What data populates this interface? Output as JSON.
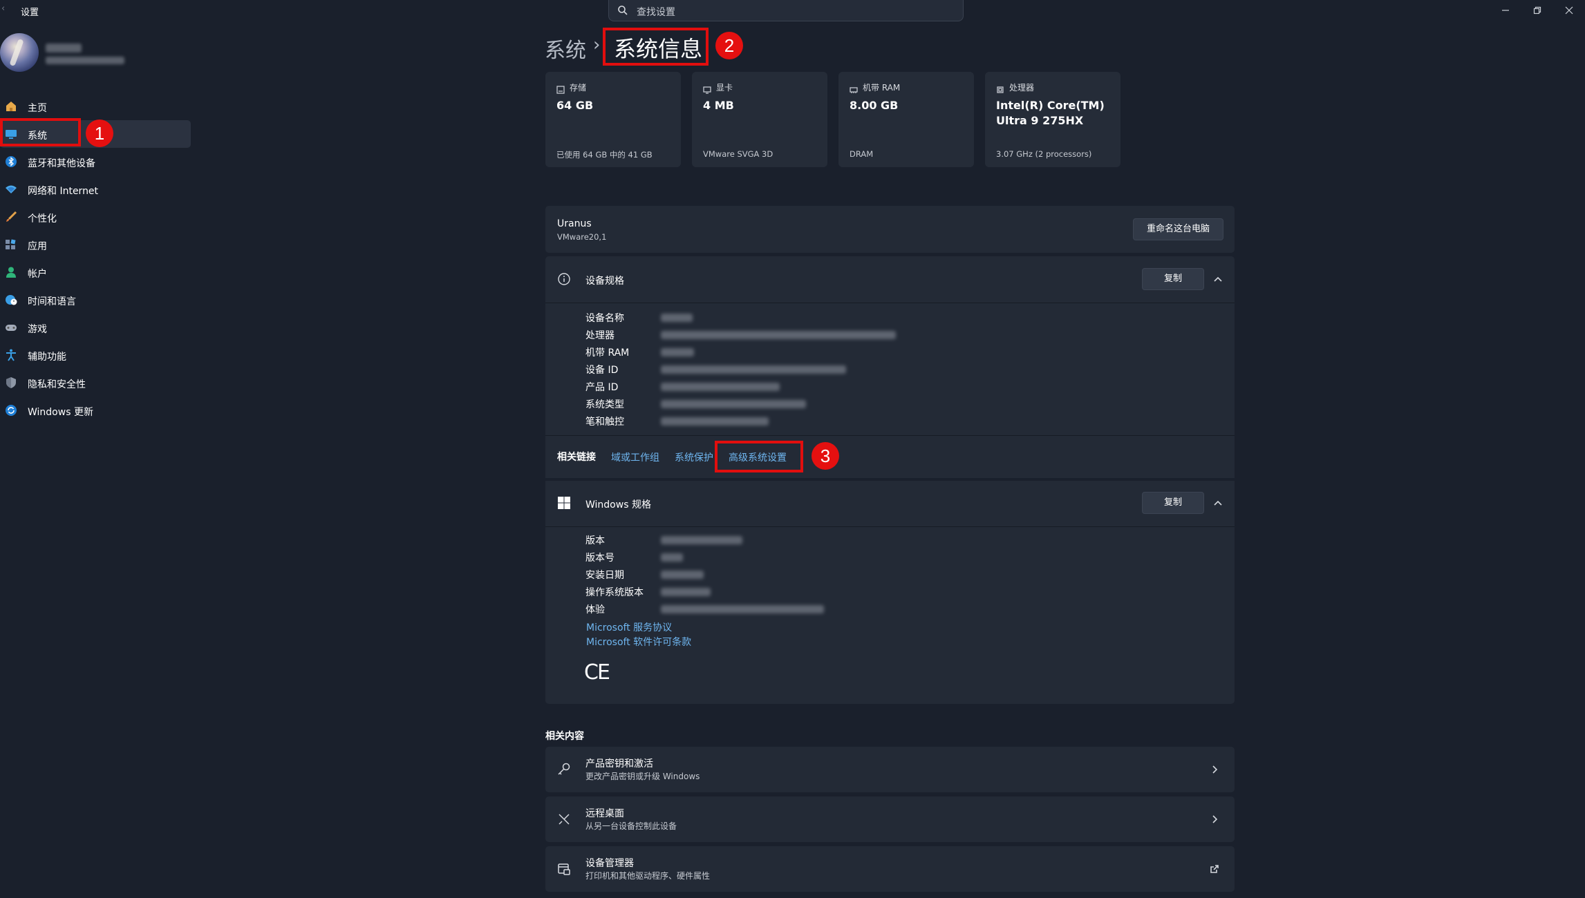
{
  "app": {
    "title": "设置"
  },
  "search": {
    "placeholder": "查找设置"
  },
  "sidebar": {
    "items": [
      {
        "label": "主页",
        "icon": "home-icon"
      },
      {
        "label": "系统",
        "icon": "system-icon"
      },
      {
        "label": "蓝牙和其他设备",
        "icon": "bluetooth-icon"
      },
      {
        "label": "网络和 Internet",
        "icon": "wifi-icon"
      },
      {
        "label": "个性化",
        "icon": "brush-icon"
      },
      {
        "label": "应用",
        "icon": "apps-icon"
      },
      {
        "label": "帐户",
        "icon": "account-icon"
      },
      {
        "label": "时间和语言",
        "icon": "globe-clock-icon"
      },
      {
        "label": "游戏",
        "icon": "gamepad-icon"
      },
      {
        "label": "辅助功能",
        "icon": "accessibility-icon"
      },
      {
        "label": "隐私和安全性",
        "icon": "shield-icon"
      },
      {
        "label": "Windows 更新",
        "icon": "update-icon"
      }
    ]
  },
  "breadcrumb": {
    "parent": "系统",
    "separator": "›",
    "current": "系统信息"
  },
  "annotations": {
    "step1": "1",
    "step2": "2",
    "step3": "3"
  },
  "cards": [
    {
      "label": "存储",
      "value": "64 GB",
      "sub": "已使用 64 GB 中的 41 GB",
      "icon": "storage-icon"
    },
    {
      "label": "显卡",
      "value": "4 MB",
      "sub": "VMware SVGA 3D",
      "icon": "display-icon"
    },
    {
      "label": "机带 RAM",
      "value": "8.00 GB",
      "sub": "DRAM",
      "icon": "ram-icon"
    },
    {
      "label": "处理器",
      "value": "Intel(R) Core(TM) Ultra 9 275HX",
      "sub": "3.07 GHz (2 processors)",
      "icon": "cpu-icon"
    }
  ],
  "pc": {
    "name": "Uranus",
    "model": "VMware20,1",
    "rename_label": "重命名这台电脑"
  },
  "device_specs": {
    "title": "设备规格",
    "copy_label": "复制",
    "labels": [
      "设备名称",
      "处理器",
      "机带 RAM",
      "设备 ID",
      "产品 ID",
      "系统类型",
      "笔和触控"
    ]
  },
  "related_links": {
    "label": "相关链接",
    "links": [
      "域或工作组",
      "系统保护",
      "高级系统设置"
    ]
  },
  "windows_specs": {
    "title": "Windows 规格",
    "copy_label": "复制",
    "labels": [
      "版本",
      "版本号",
      "安装日期",
      "操作系统版本",
      "体验"
    ],
    "links": [
      "Microsoft 服务协议",
      "Microsoft 软件许可条款"
    ],
    "ce": "CE"
  },
  "related_content": {
    "heading": "相关内容",
    "items": [
      {
        "title": "产品密钥和激活",
        "sub": "更改产品密钥或升级 Windows",
        "icon": "key-icon"
      },
      {
        "title": "远程桌面",
        "sub": "从另一台设备控制此设备",
        "icon": "remote-desktop-icon"
      },
      {
        "title": "设备管理器",
        "sub": "打印机和其他驱动程序、硬件属性",
        "icon": "device-manager-icon"
      }
    ]
  },
  "colors": {
    "accent_link": "#6fb6f0",
    "annotation_red": "#e10e0e",
    "background": "#1a202c",
    "panel": "#232a36"
  }
}
